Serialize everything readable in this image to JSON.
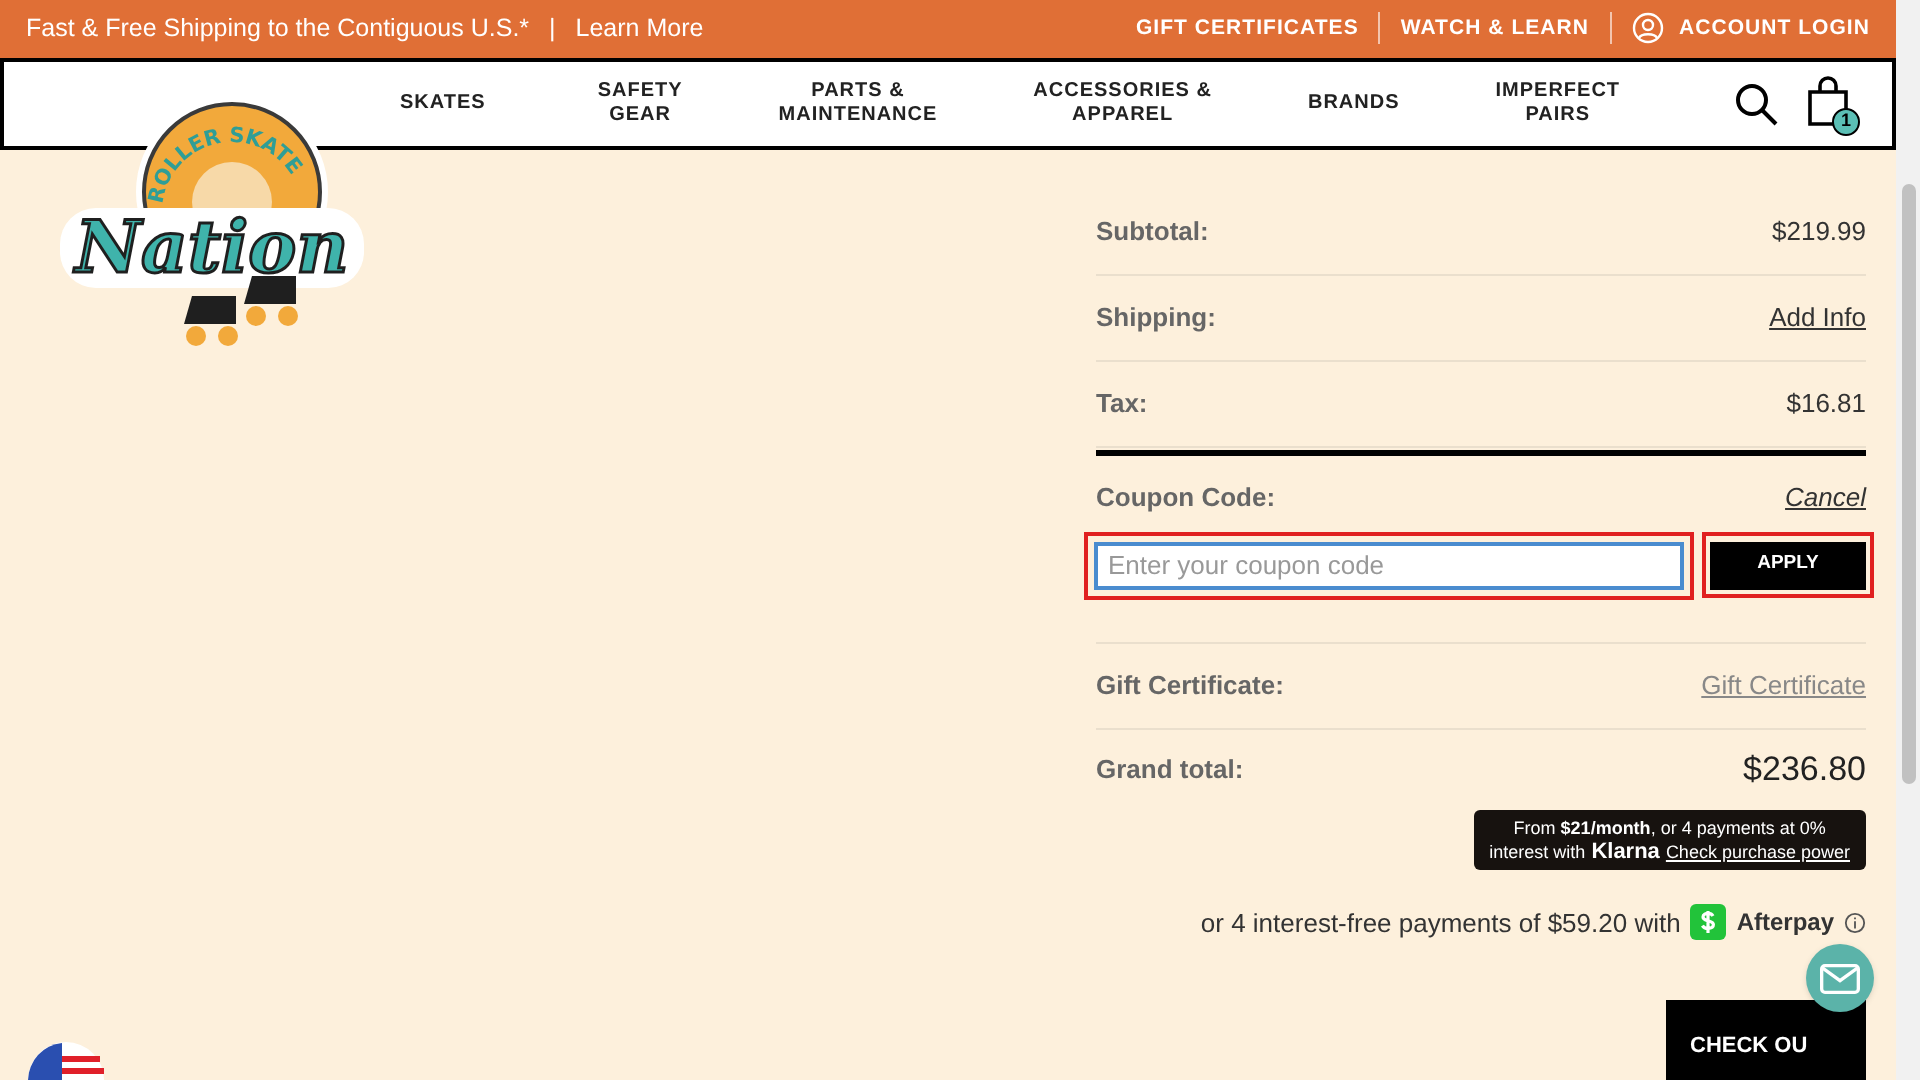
{
  "promo_bar": {
    "text": "Fast & Free Shipping to the Contiguous U.S.*",
    "separator": "|",
    "link": "Learn More",
    "links": [
      "GIFT CERTIFICATES",
      "WATCH & LEARN",
      "ACCOUNT LOGIN"
    ]
  },
  "logo": {
    "top_text": "ROLLER SKATE",
    "script_text": "Nation"
  },
  "nav": {
    "items": [
      [
        "SKATES"
      ],
      [
        "SAFETY",
        "GEAR"
      ],
      [
        "PARTS &",
        "MAINTENANCE"
      ],
      [
        "ACCESSORIES &",
        "APPAREL"
      ],
      [
        "BRANDS"
      ],
      [
        "IMPERFECT",
        "PAIRS"
      ]
    ],
    "cart_count": "1"
  },
  "summary": {
    "rows": [
      {
        "label": "Subtotal:",
        "value": "$219.99",
        "kind": "text"
      },
      {
        "label": "Shipping:",
        "value": "Add Info",
        "kind": "link"
      },
      {
        "label": "Tax:",
        "value": "$16.81",
        "kind": "text"
      }
    ],
    "coupon": {
      "label": "Coupon Code:",
      "cancel": "Cancel",
      "placeholder": "Enter your coupon code",
      "button": "APPLY",
      "highlighted": true
    },
    "gift": {
      "label": "Gift Certificate:",
      "link": "Gift Certificate"
    },
    "grand_total": {
      "label": "Grand total:",
      "value": "$236.80"
    },
    "klarna": {
      "line1": "From **$21/month**, or 4 payments at 0%",
      "line2": "interest with",
      "brand": "Klarna",
      "link": "Check purchase power"
    },
    "afterpay": {
      "text": "or 4 interest-free payments of $59.20 with",
      "brand": "Afterpay"
    },
    "checkout": "CHECK OU"
  }
}
